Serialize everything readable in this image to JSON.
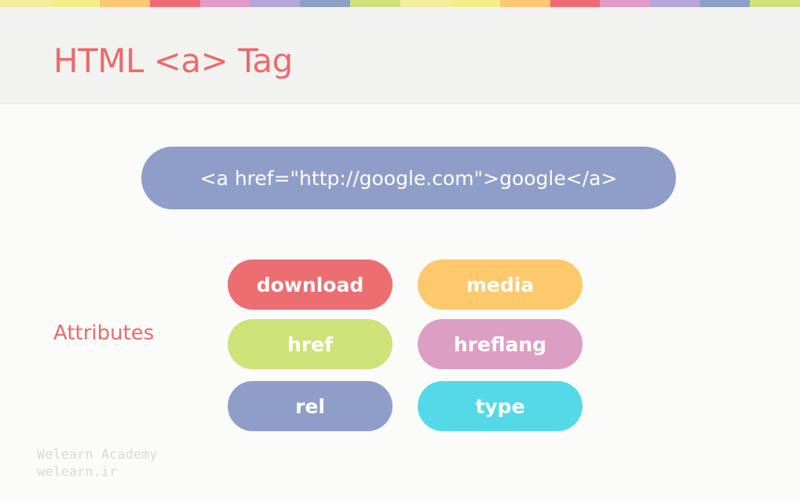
{
  "slide": {
    "title": "HTML <a> Tag",
    "code_example": "<a href=\"http://google.com\">google</a>",
    "attributes_label": "Attributes",
    "attributes": [
      {
        "label": "download",
        "color": "#ed6e71"
      },
      {
        "label": "media",
        "color": "#fdc96c"
      },
      {
        "label": "href",
        "color": "#cfe27a"
      },
      {
        "label": "hreflang",
        "color": "#dc9fc3"
      },
      {
        "label": "rel",
        "color": "#8f9ec9"
      },
      {
        "label": "type",
        "color": "#55d9e8"
      }
    ]
  },
  "watermark": {
    "line1": "Welearn Academy",
    "line2": "welearn.ir"
  },
  "colors": {
    "accent": "#ea6b6b",
    "code_pill": "#8f9ec9",
    "header_bg": "#f2f2f0",
    "background": "#fbfbf9",
    "top_strip": [
      "#f3ee9b",
      "#f5ec8c",
      "#fcc873",
      "#ef6a72",
      "#e29cc8",
      "#b7a4d8",
      "#8a9ec6",
      "#d2e07e",
      "#f3ee9b",
      "#f5ec8c",
      "#fcc873",
      "#ef6a72",
      "#e29cc8",
      "#b7a4d8",
      "#8a9ec6",
      "#d2e07e"
    ]
  }
}
